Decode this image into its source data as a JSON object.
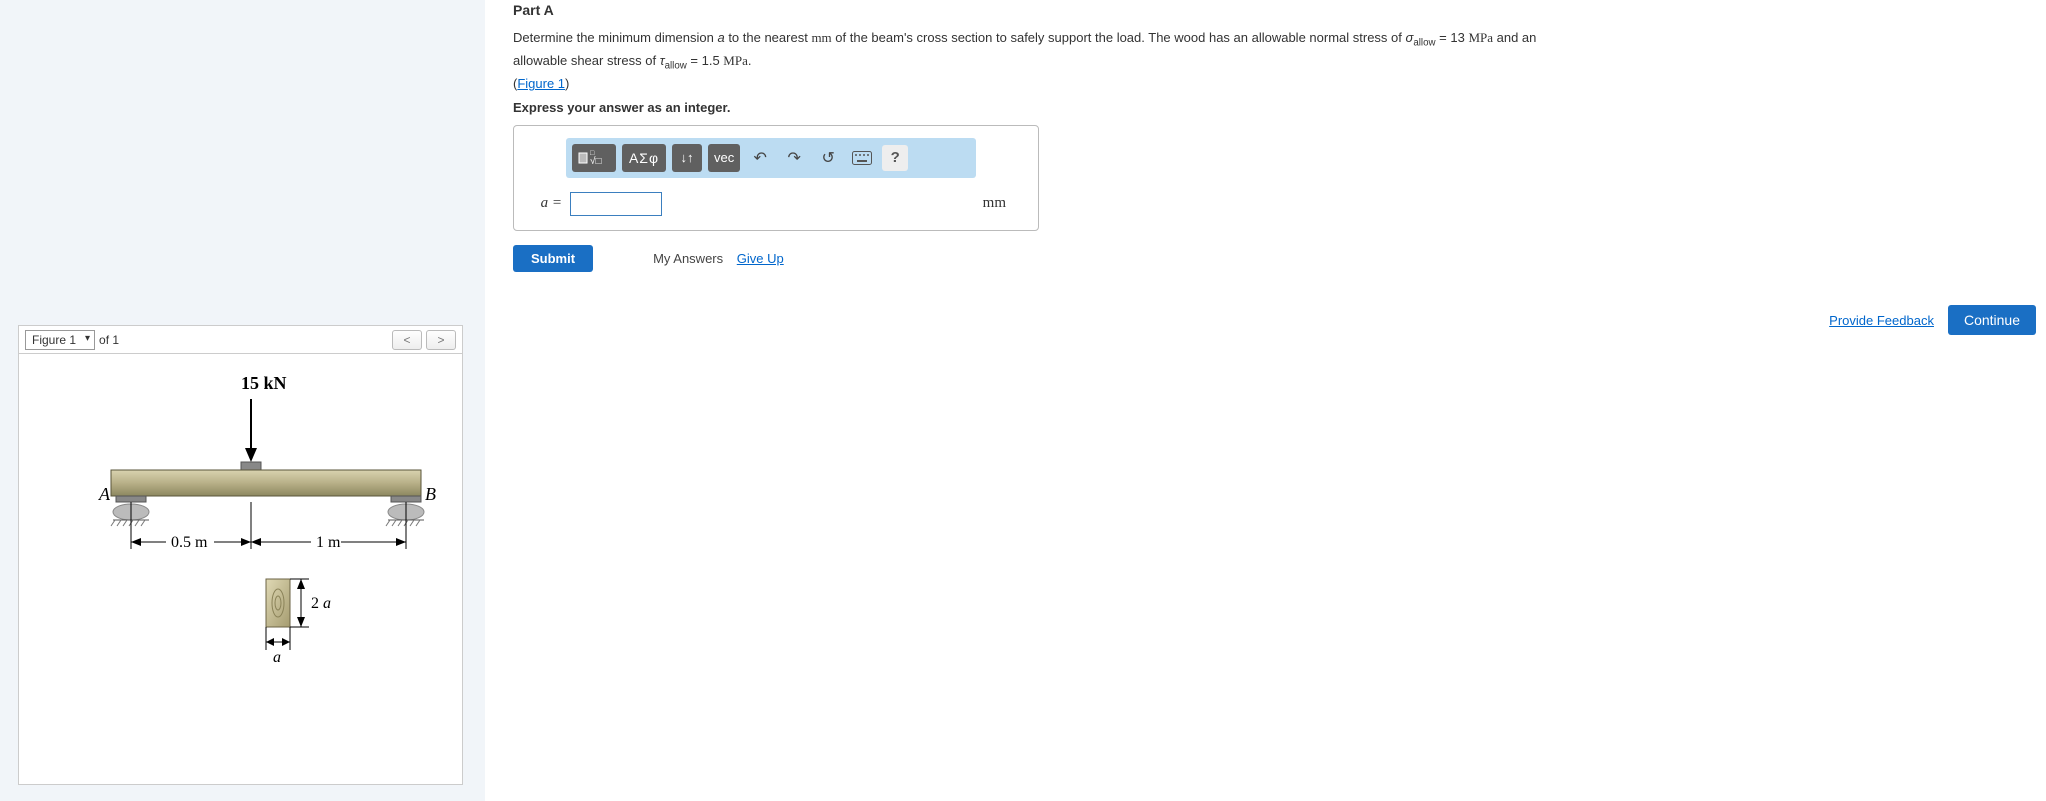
{
  "figure_panel": {
    "selector_label": "Figure 1",
    "of_text": "of 1",
    "prev": "<",
    "next": ">",
    "force_label": "15 kN",
    "point_A": "A",
    "point_B": "B",
    "dim_05": "0.5 m",
    "dim_1": "1 m",
    "dim_2a": "2 a",
    "dim_a": "a"
  },
  "part": {
    "title": "Part A",
    "prompt_prefix": "Determine the minimum dimension ",
    "var_a": "a",
    "prompt_mid1": " to the nearest ",
    "unit_mm_serif": "mm",
    "prompt_mid2": " of the beam's cross section to safely support the load. The wood has an allowable normal stress of ",
    "sigma_label": "σ",
    "allow_sub": "allow",
    "equals_13": " = 13 ",
    "mpa": "MPa",
    "prompt_mid3": " and an allowable shear stress of ",
    "tau_label": "τ",
    "equals_15": " = 1.5 ",
    "period": ".",
    "figure_link": "Figure 1",
    "lp": "(",
    "rp": ")",
    "express_line": "Express your answer as an integer."
  },
  "toolbar": {
    "greek": "ΑΣφ",
    "vec": "vec",
    "updown": "↓↑",
    "undo": "↶",
    "redo": "↷",
    "reset": "↺",
    "help": "?"
  },
  "answer": {
    "label": "a =",
    "unit": "mm",
    "value": ""
  },
  "actions": {
    "submit": "Submit",
    "my_answers": "My Answers",
    "give_up": "Give Up",
    "provide_feedback": "Provide Feedback",
    "continue": "Continue"
  }
}
